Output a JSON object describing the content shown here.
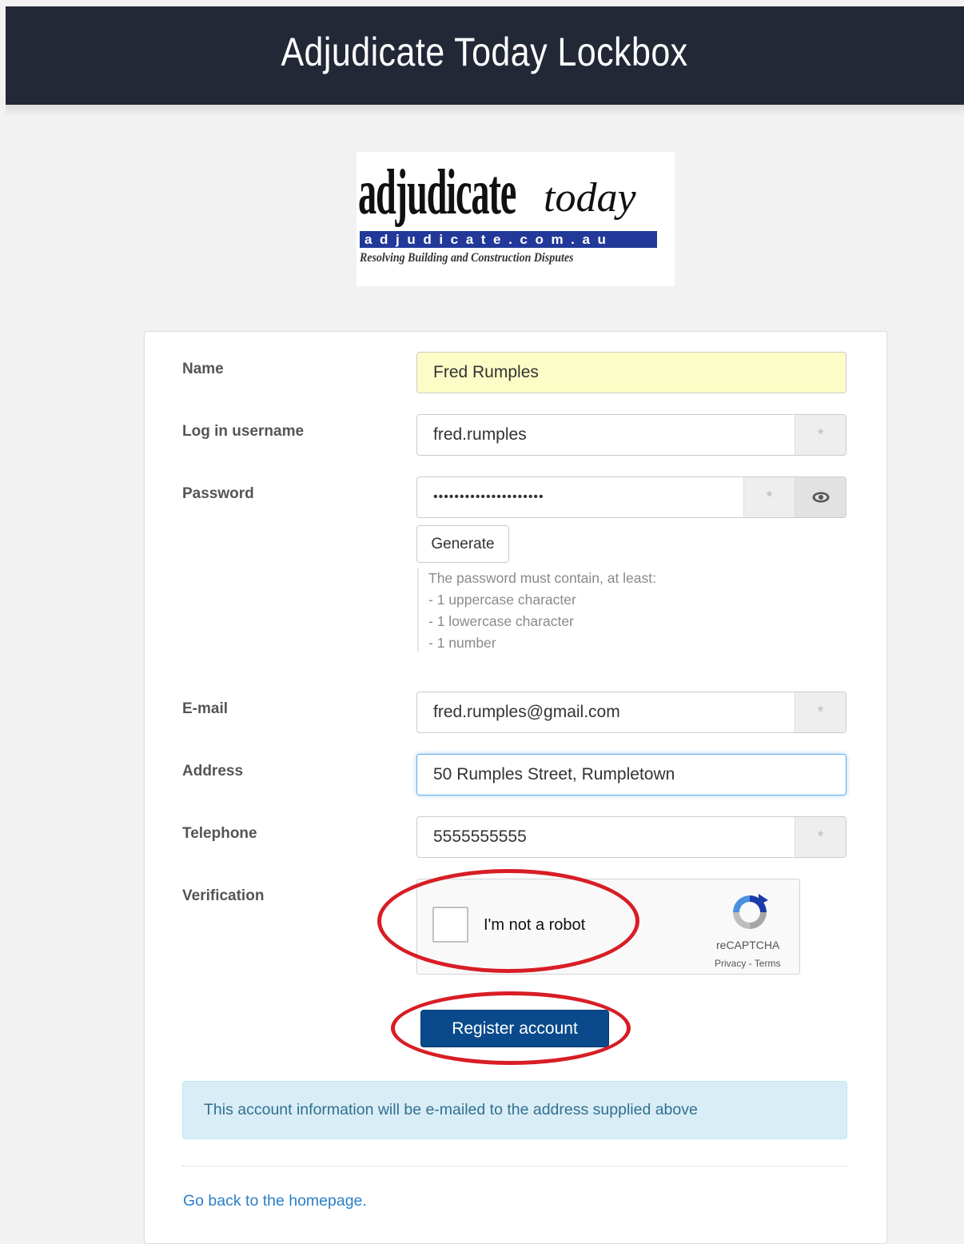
{
  "header": {
    "title": "Adjudicate Today Lockbox"
  },
  "logo": {
    "word": "adjudicate",
    "today": "today",
    "domain": "adjudicate.com.au",
    "tagline": "Resolving Building and Construction Disputes"
  },
  "form": {
    "name": {
      "label": "Name",
      "value": "Fred Rumples"
    },
    "username": {
      "label": "Log in username",
      "value": "fred.rumples"
    },
    "password": {
      "label": "Password",
      "value": "•••••••••••••••••••••",
      "generate_label": "Generate",
      "help": [
        "The password must contain, at least:",
        "- 1 uppercase character",
        "- 1 lowercase character",
        "- 1 number"
      ]
    },
    "email": {
      "label": "E-mail",
      "value": "fred.rumples@gmail.com"
    },
    "address": {
      "label": "Address",
      "value": "50 Rumples Street, Rumpletown"
    },
    "telephone": {
      "label": "Telephone",
      "value": "5555555555"
    },
    "verification": {
      "label": "Verification",
      "checkbox_label": "I'm not a robot",
      "brand": "reCAPTCHA",
      "links": "Privacy - Terms"
    },
    "required_mark": "*",
    "submit_label": "Register account"
  },
  "info_message": "This account information will be e-mailed to the address supplied above",
  "footer": {
    "home_link": "Go back to the homepage."
  },
  "colors": {
    "header_bg": "#222836",
    "primary_button": "#0a4a8c",
    "highlight_ellipse": "#d81d25",
    "info_bg": "#d9edf7"
  }
}
